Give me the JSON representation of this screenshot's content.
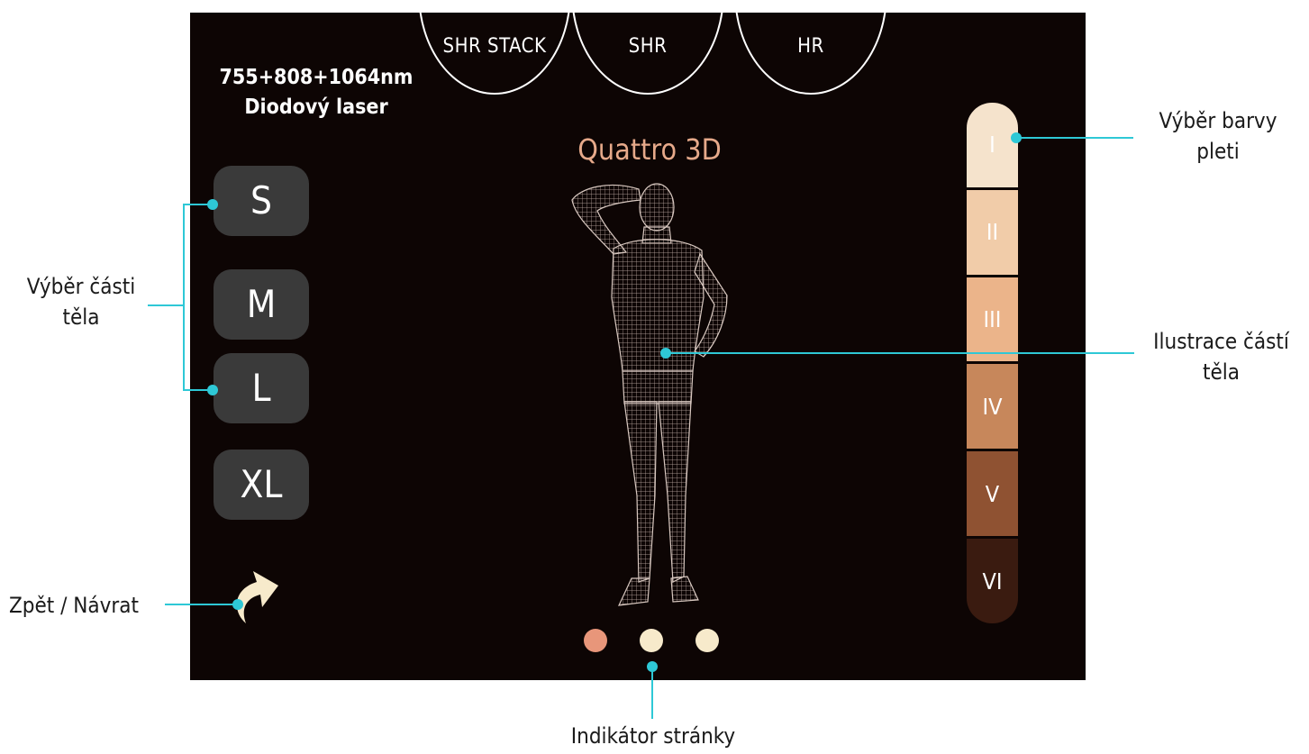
{
  "mode_tabs": [
    "SHR STACK",
    "SHR",
    "HR"
  ],
  "laser": {
    "line1": "755+808+1064nm",
    "line2": "Diodový laser"
  },
  "brand": "Quattro 3D",
  "size_buttons": [
    "S",
    "M",
    "L",
    "XL"
  ],
  "skin_types": [
    {
      "label": "I",
      "color": "#f5e3cc"
    },
    {
      "label": "II",
      "color": "#f1cca9"
    },
    {
      "label": "III",
      "color": "#ebb48a"
    },
    {
      "label": "IV",
      "color": "#c7875b"
    },
    {
      "label": "V",
      "color": "#8f5232"
    },
    {
      "label": "VI",
      "color": "#3a1b10"
    }
  ],
  "page_indicator": {
    "count": 3,
    "active": 0,
    "active_color": "#e8967a",
    "inactive_color": "#f7eacb"
  },
  "annotations": {
    "skin_color": {
      "line1": "Výběr barvy",
      "line2": "pleti"
    },
    "body_part": {
      "line1": "Výběr části",
      "line2": "těla"
    },
    "body_illustration": {
      "line1": "Ilustrace částí",
      "line2": "těla"
    },
    "back": "Zpět / Návrat",
    "page": "Indikátor stránky"
  },
  "icons": {
    "back": "curved-arrow-icon"
  },
  "colors": {
    "screen_bg": "#0d0504",
    "annotation_line": "#2ec8d6",
    "brand": "#e6a98a"
  }
}
